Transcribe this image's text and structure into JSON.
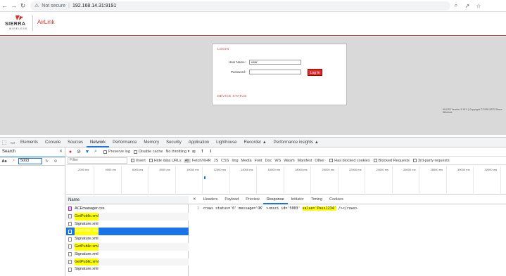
{
  "browser": {
    "back_icon": "←",
    "forward_icon": "→",
    "reload_icon": "↻",
    "security_text": "Not secure",
    "url": "192.168.14.31:9191",
    "zoom_icon": "⌕",
    "share_icon": "↗",
    "star_icon": "☆"
  },
  "header": {
    "brand": "SIERRA",
    "brand_sub": "WIRELESS",
    "product": "AirLink"
  },
  "login": {
    "heading": "LOGIN",
    "username_label": "User Name:",
    "username_value": "user",
    "password_label": "Password:",
    "button": "Log In",
    "device_status": "DEVICE STATUS"
  },
  "footer_text": "ALEOS Version 4.15.0 | Copyright © 2008-2022 Sierra Wireless",
  "devtools": {
    "tabs": [
      "Elements",
      "Console",
      "Sources",
      "Network",
      "Performance",
      "Memory",
      "Security",
      "Application",
      "Lighthouse",
      "Recorder ▲",
      "Performance insights ▲"
    ],
    "active_tab": "Network",
    "search_label": "Search",
    "search_value": "5003",
    "network_toolbar": {
      "preserve_log": "Preserve log",
      "disable_cache": "Disable cache",
      "throttling": "No throttling ▾"
    },
    "filter": {
      "placeholder": "Filter",
      "invert": "Invert",
      "hide_data_urls": "Hide data URLs",
      "types": [
        "All",
        "Fetch/XHR",
        "JS",
        "CSS",
        "Img",
        "Media",
        "Font",
        "Doc",
        "WS",
        "Wasm",
        "Manifest",
        "Other"
      ],
      "has_blocked_cookies": "Has blocked cookies",
      "blocked_requests": "Blocked Requests",
      "third_party": "3rd-party requests"
    },
    "timeline_ticks": [
      "2000 ms",
      "4000 ms",
      "6000 ms",
      "8000 ms",
      "10000 ms",
      "12000 ms",
      "14000 ms",
      "16000 ms",
      "18000 ms",
      "20000 ms",
      "22000 ms",
      "24000 ms",
      "26000 ms",
      "28000 ms",
      "30000 ms",
      "32000 ms"
    ],
    "name_header": "Name",
    "requests": [
      {
        "name": "ACEmanager.css",
        "kind": "css",
        "highlight": false,
        "selected": false
      },
      {
        "name": "GetPublic.xml",
        "kind": "xml",
        "highlight": true,
        "selected": false
      },
      {
        "name": "Signature.xml",
        "kind": "xml",
        "highlight": false,
        "selected": false
      },
      {
        "name": "GetPublic.xml",
        "kind": "xml",
        "highlight": true,
        "selected": true
      },
      {
        "name": "Signature.xml",
        "kind": "xml",
        "highlight": false,
        "selected": false
      },
      {
        "name": "GetPublic.xml",
        "kind": "xml",
        "highlight": true,
        "selected": false
      },
      {
        "name": "Signature.xml",
        "kind": "xml",
        "highlight": false,
        "selected": false
      },
      {
        "name": "GetPublic.xml",
        "kind": "xml",
        "highlight": true,
        "selected": false
      },
      {
        "name": "Signature.xml",
        "kind": "xml",
        "highlight": false,
        "selected": false
      }
    ],
    "detail_tabs": [
      "Headers",
      "Payload",
      "Preview",
      "Response",
      "Initiator",
      "Timing",
      "Cookies"
    ],
    "active_detail_tab": "Response",
    "response": {
      "line_number": "1",
      "before": "<rows status='0' message='OK' ><msci id='5003' ",
      "highlight": "value='Pass1234'",
      "after": " /></rows>"
    }
  },
  "colors": {
    "brand_red": "#d32f2f",
    "devtools_blue": "#1a73e8",
    "highlight_yellow": "#ffff00"
  }
}
